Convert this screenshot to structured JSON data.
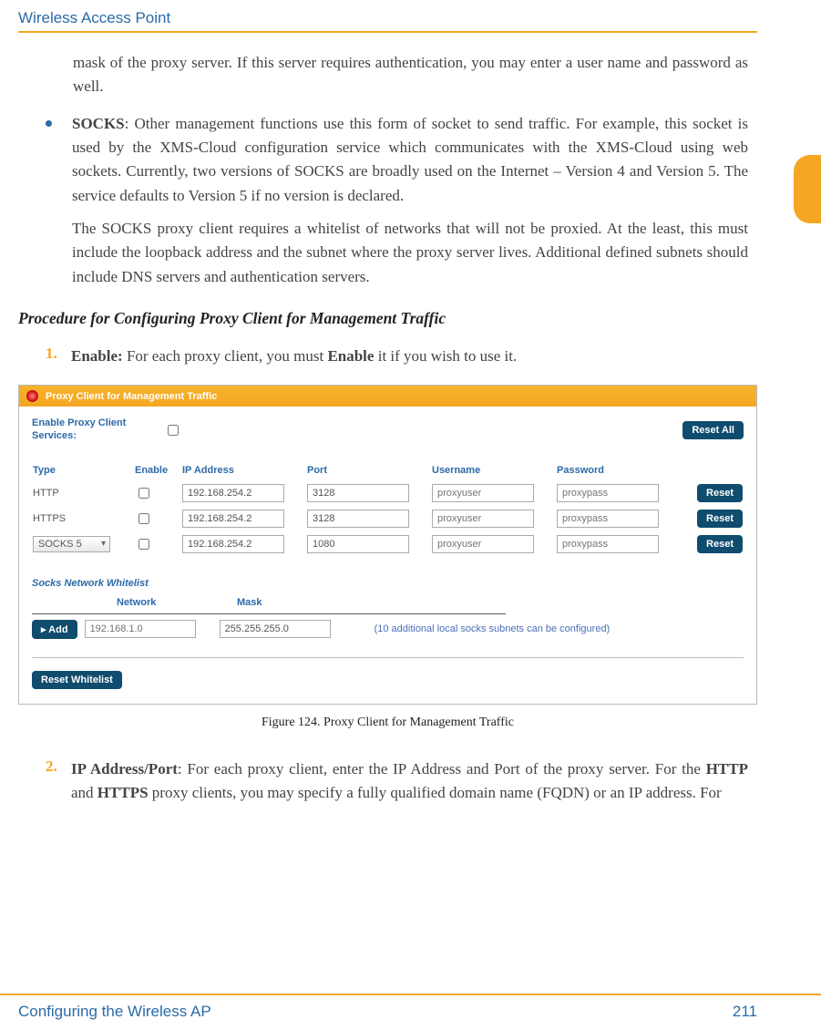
{
  "header": {
    "title": "Wireless Access Point"
  },
  "para": {
    "mask": "mask of the proxy server. If this server requires authentication, you may enter a user name and password as well.",
    "socks_label": "SOCKS",
    "socks_body": ": Other management functions use this form of socket to send traffic. For example, this socket is used by the XMS-Cloud configuration service which communicates with the XMS-Cloud using web sockets. Currently, two versions of SOCKS are broadly used on the Internet – Version 4 and Version 5. The service defaults to Version 5 if no version is declared.",
    "socks_more": "The SOCKS proxy client requires a whitelist of networks that will not be proxied. At the least, this must include the loopback address and the subnet where the proxy server lives. Additional defined subnets should include DNS servers and authentication servers."
  },
  "procedure_title": "Procedure for Configuring Proxy Client for Management Traffic",
  "steps": {
    "s1_num": "1.",
    "s1_label": "Enable:",
    "s1_body": " For each proxy client, you must ",
    "s1_bold": "Enable",
    "s1_tail": " it if you wish to use it.",
    "s2_num": "2.",
    "s2_label": "IP Address/Port",
    "s2_body": ": For each proxy client, enter the IP Address and Port of the proxy server. For the ",
    "s2_b1": "HTTP",
    "s2_mid": " and ",
    "s2_b2": "HTTPS",
    "s2_tail": " proxy clients, you may specify a fully qualified domain name (FQDN) or an IP address. For"
  },
  "figure": {
    "banner": "Proxy Client for Management Traffic",
    "enable_label": "Enable Proxy Client Services:",
    "reset_all": "Reset All",
    "cols": {
      "type": "Type",
      "enable": "Enable",
      "ip": "IP Address",
      "port": "Port",
      "user": "Username",
      "pass": "Password"
    },
    "rows": [
      {
        "type": "HTTP",
        "ip": "192.168.254.2",
        "port": "3128",
        "user": "proxyuser",
        "pass": "proxypass"
      },
      {
        "type": "HTTPS",
        "ip": "192.168.254.2",
        "port": "3128",
        "user": "proxyuser",
        "pass": "proxypass"
      },
      {
        "type": "SOCKS 5",
        "ip": "192.168.254.2",
        "port": "1080",
        "user": "proxyuser",
        "pass": "proxypass"
      }
    ],
    "reset": "Reset",
    "whitelist_title": "Socks Network Whitelist",
    "wl_cols": {
      "network": "Network",
      "mask": "Mask"
    },
    "wl_row": {
      "network": "192.168.1.0",
      "mask": "255.255.255.0"
    },
    "add": "▸ Add",
    "note": "(10 additional local socks subnets can be configured)",
    "reset_wl": "Reset Whitelist"
  },
  "caption": "Figure 124. Proxy Client for Management Traffic",
  "footer": {
    "left": "Configuring the Wireless AP",
    "right": "211"
  }
}
